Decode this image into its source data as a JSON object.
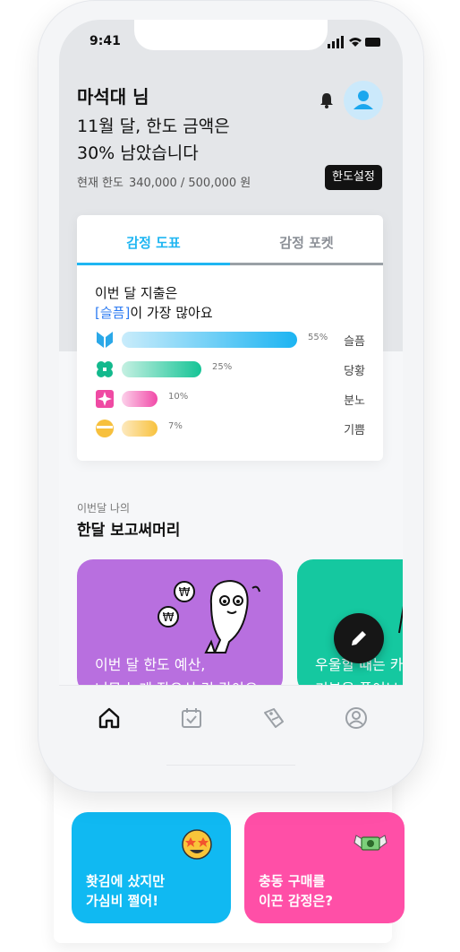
{
  "status": {
    "time": "9:41"
  },
  "header": {
    "greeting": "마석대 님",
    "headline": "11월 달, 한도 금액은\n30% 남았습니다",
    "limit_label": "현재 한도",
    "limit_value": "340,000 / 500,000 원",
    "limit_button": "한도설정"
  },
  "emotion_card": {
    "tabs": [
      {
        "label": "감정 도표",
        "active": true
      },
      {
        "label": "감정 포켓",
        "active": false
      }
    ],
    "summary_line1": "이번 달 지출은",
    "summary_highlight": "[슬픔]",
    "summary_rest": "이 가장 많아요",
    "rows": [
      {
        "emotion": "슬픔",
        "percent": "55%",
        "value": 0.55,
        "icon": "sad-icon",
        "color_from": "#c9ecfb",
        "color_to": "#1cb4f2"
      },
      {
        "emotion": "당황",
        "percent": "25%",
        "value": 0.25,
        "icon": "panic-icon",
        "color_from": "#c5f0e2",
        "color_to": "#15c496"
      },
      {
        "emotion": "분노",
        "percent": "10%",
        "value": 0.1,
        "icon": "anger-icon",
        "color_from": "#fcd1ea",
        "color_to": "#f14aa8"
      },
      {
        "emotion": "기쁨",
        "percent": "7%",
        "value": 0.07,
        "icon": "joy-icon",
        "color_from": "#fde9bf",
        "color_to": "#f8c23e"
      }
    ]
  },
  "report": {
    "subtitle": "이번달 나의",
    "title": "한달 보고써머리",
    "cards": [
      {
        "text": "이번 달 한도 예산,\n너무 높게 잡으신 것 같아요",
        "color": "#b86fdf"
      },
      {
        "text": "우울할 때는 카\n기분을 풀어보",
        "color": "#15c8a0"
      }
    ]
  },
  "tabbar": {
    "items": [
      "home-icon",
      "calendar-check-icon",
      "tag-icon",
      "profile-icon"
    ]
  },
  "promos": [
    {
      "text": "홧김에 샀지만\n가심비 쩔어!",
      "color": "#10b9f2",
      "icon": "star-eyes-emoji"
    },
    {
      "text": "충동 구매를\n이끈 감정은?",
      "color": "#ff4fa7",
      "icon": "money-wings-emoji"
    }
  ]
}
